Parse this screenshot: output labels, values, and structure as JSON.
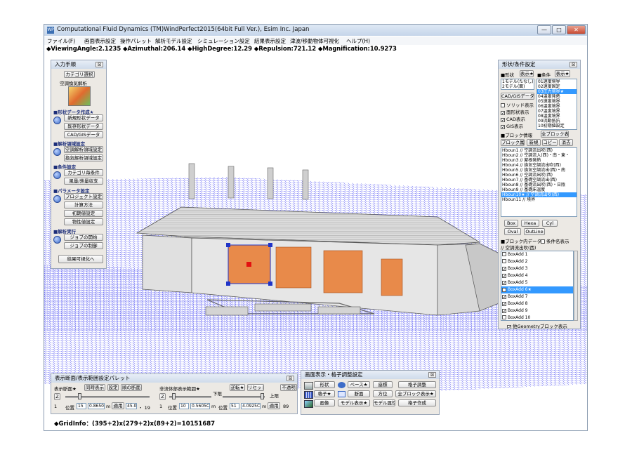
{
  "window": {
    "icon_text": "WP",
    "title": "Computational Fluid Dynamics (TM)WindPerfect2015(64bit Full Ver.), Esim Inc. Japan",
    "minimize": "—",
    "maximize": "□",
    "close": "✕"
  },
  "menu": [
    "ファイル(F)",
    "画面表示設定",
    "操作パレット",
    "解析モデル設定",
    "シミュレーション設定",
    "結果表示設定",
    "津波/移動物体可視化",
    "ヘルプ(H)"
  ],
  "status": "◆ViewingAngle:2.1235 ◆Azimuthal:206.14 ◆HighDegree:12.29 ◆Repulsion:721.12 ◆Magnification:10.9273",
  "colors": {
    "mesh": "#4b4ef2",
    "heated": "#e88a4a",
    "selection": "#3399ff",
    "building": "#d8d8d8"
  },
  "input_panel": {
    "title": "入力手順",
    "close": "☒",
    "category_btn": "カテゴリ選択",
    "category_label": "空調換気解析",
    "sec_shape": "■形状データ作成★",
    "btn_new_shape": "新規形状データ",
    "btn_existing_shape": "既存形状データ",
    "btn_cad": "CAD/GISデータ",
    "sec_analysis": "■解析領域設定",
    "btn_region_setting": "空調解析領域設定",
    "btn_ventilation_setting": "換気解析領域設定",
    "sec_condition": "■条件設定",
    "btn_category_cond": "カテゴリ毎条件",
    "btn_wind_heat": "風量/熱量収支",
    "sec_param": "■パラメータ設定",
    "btn_project_setting": "プロジェクト設定",
    "btn_calc_method": "計算方法",
    "btn_initial": "初期値設定",
    "btn_property": "物性値設定",
    "sec_run": "■解析実行",
    "btn_job_start": "ジョブの開始",
    "btn_job_control": "ジョブの制御",
    "btn_result_viz": "結果可視化へ"
  },
  "shape_panel": {
    "title": "形状/条件設定",
    "close": "☒",
    "shape_label": "■形状",
    "display_btn": "表示★",
    "condition_label": "■条件",
    "display_btn2": "表示★",
    "shape_list": [
      "1モデル(たなし)★",
      "2モデル(面)"
    ],
    "condition_list": [
      "01速度境界",
      "02速度固定",
      "03圧力境界★",
      "04温度発熱",
      "05速度境界",
      "06温度境界",
      "07温度境界",
      "08温度境界",
      "09流動抵抗",
      "10初期値設定"
    ],
    "cad_gis_btn": "CAD/GISデータ",
    "solid_display": "ソリッド表示",
    "shape_display": "面形状表示",
    "cad_display": "CAD表示",
    "gis_display": "GIS表示",
    "block_info": "■ブロック情報",
    "all_block_display": "全ブロック表示",
    "block_attr_btn": "ブロック属性",
    "new_btn": "新規",
    "copy_btn": "コピー",
    "delete_btn": "消去",
    "hbound_list": [
      "Hboun1 // 空調流出吹(西)",
      "Hboun2 // 空調流入(西)・南・東・",
      "Hboun3 // 屋根発熱",
      "Hboun4 // 換気空調流出吹(西)",
      "Hboun5 // 換気空調流出(西)・南",
      "Hboun6 // 空調流出吹(西)",
      "Hboun7 // 基礎空調流出(西)",
      "Hboun8 // 基礎流出吹(西)・日陰",
      "Hboun9 // 基礎床温度",
      "Hboun10★ // 空調流出吹(西)",
      "Hboun11 // 境界"
    ],
    "shape_btns": [
      "Box",
      "Hexa",
      "Cyl",
      "Oval",
      "OutLine"
    ],
    "block_data_label": "■ブロック内データ",
    "condition_name_display": "条件名表示",
    "condition_name_value": "// 空調流出吹(西)",
    "boxadd_list": [
      {
        "label": "BoxAdd 1",
        "checked": false
      },
      {
        "label": "BoxAdd 2",
        "checked": false
      },
      {
        "label": "BoxAdd 3",
        "checked": true
      },
      {
        "label": "BoxAdd 4",
        "checked": true
      },
      {
        "label": "BoxAdd 5",
        "checked": true
      },
      {
        "label": "BoxAdd 6★",
        "checked": true
      },
      {
        "label": "BoxAdd 7",
        "checked": true
      },
      {
        "label": "BoxAdd 8",
        "checked": true
      },
      {
        "label": "BoxAdd 9",
        "checked": true
      },
      {
        "label": "BoxAdd 10",
        "checked": false
      }
    ],
    "other_geometry": "他Geometryブロック表示"
  },
  "section_panel": {
    "title": "表示断面/表示範囲設定パレット",
    "close": "☒",
    "display_section": "表示断面★",
    "sync_display": "同時表示",
    "setting": "設定",
    "sub_section": "順の断面",
    "fluid_display": "非流体部表示範囲★",
    "lower": "下限",
    "upper": "上限",
    "reverse_btn": "逆転★",
    "reset_btn": "リセット",
    "invisible_btn": "不透明",
    "z_label": "Z",
    "z_label2": "Z",
    "one": "1",
    "one2": "1",
    "pos_label": "位置",
    "pos_val": "15",
    "pos_m": "0.8650",
    "m": "m",
    "apply": "適用",
    "deg": "45.0",
    "tail": "・ 19",
    "pos_label2": "位置",
    "pos_val2": "10",
    "pos_m2": "0.5605C",
    "m2": "m",
    "pos_label3": "位置",
    "pos_val3": "51",
    "pos_m3": "4.0925C",
    "m3": "m",
    "apply2": "適用",
    "end_val": "89"
  },
  "grid_panel": {
    "title": "画面表示・格子調整設定",
    "close": "☒",
    "shape": "形状",
    "grid": "格子★",
    "image": "画像",
    "base": "ベース★",
    "section": "断面",
    "model_display": "モデル表示★",
    "coords": "座標",
    "direction": "方位",
    "model_attr": "モデル属性",
    "grid_adjust": "格子調整",
    "all_display": "全ブロック表示★",
    "grid_create": "格子作成"
  },
  "grid_info": "◆GridInfo：(395+2)x(279+2)x(89+2)=10151687"
}
